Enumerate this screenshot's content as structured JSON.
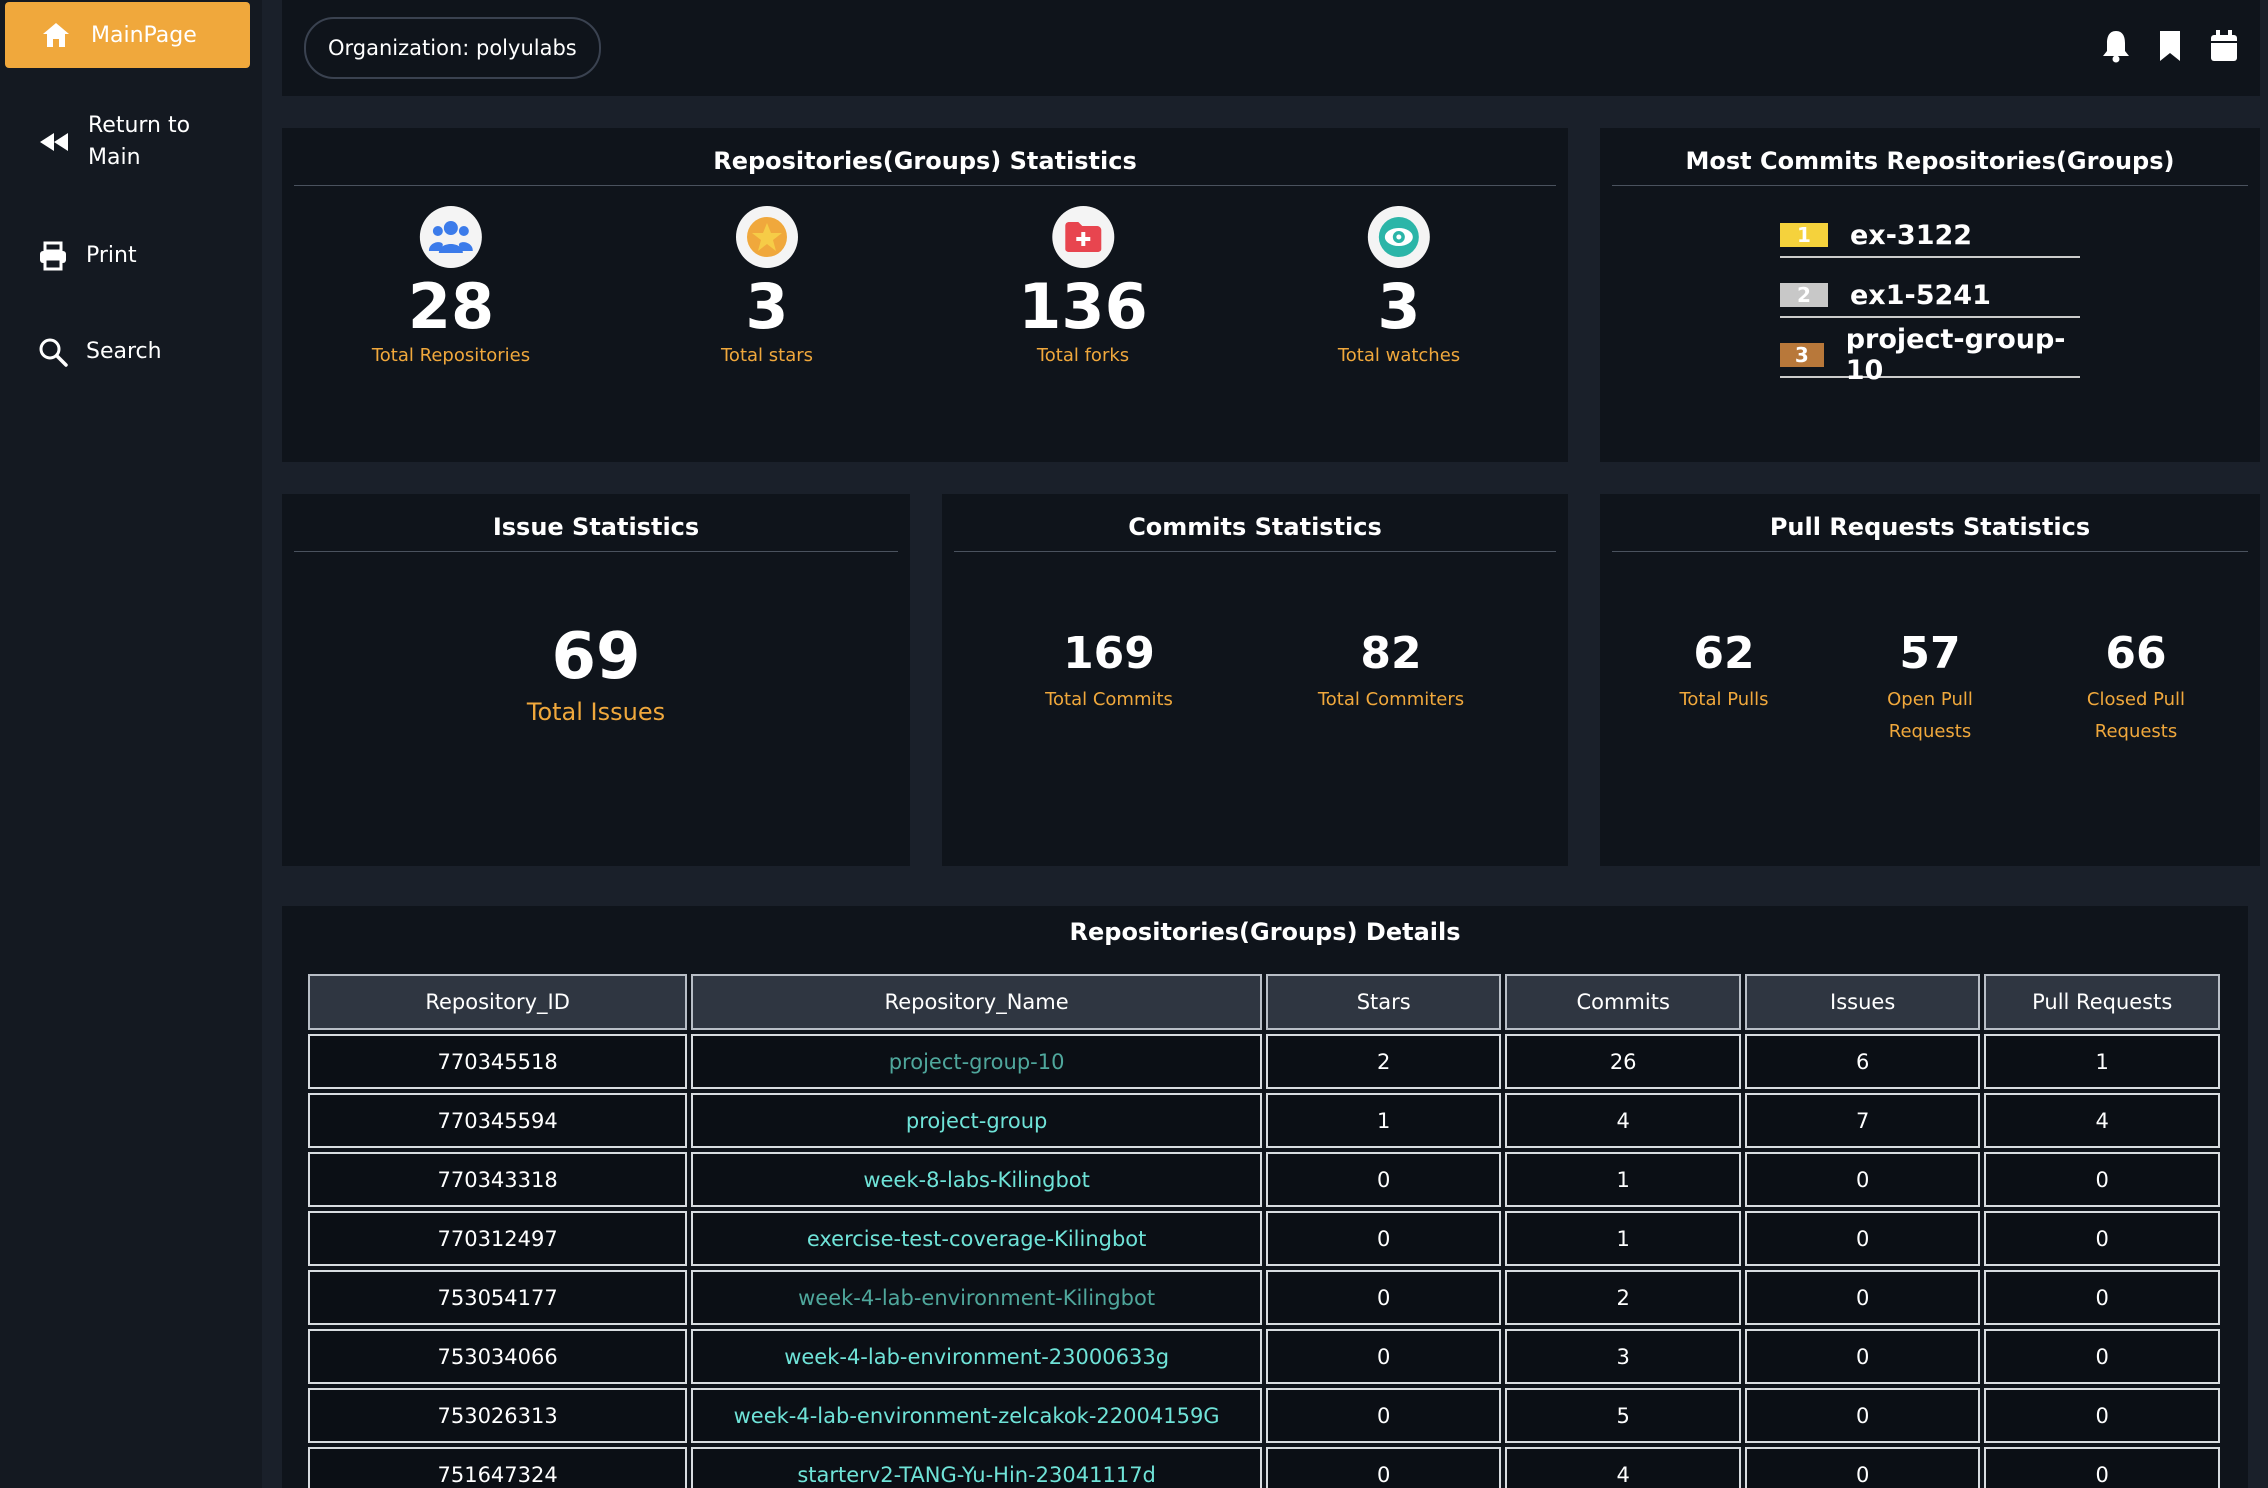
{
  "sidebar": {
    "main": "MainPage",
    "return": "Return to Main",
    "print": "Print",
    "search": "Search"
  },
  "header": {
    "organization": "Organization: polyulabs",
    "icons": [
      "bell-icon",
      "bookmark-icon",
      "calendar-icon"
    ]
  },
  "repo_stats": {
    "title": "Repositories(Groups) Statistics",
    "items": [
      {
        "value": "28",
        "label": "Total Repositories",
        "icon": "users-icon"
      },
      {
        "value": "3",
        "label": "Total stars",
        "icon": "star-icon"
      },
      {
        "value": "136",
        "label": "Total forks",
        "icon": "folder-plus-icon"
      },
      {
        "value": "3",
        "label": "Total watches",
        "icon": "eye-icon"
      }
    ]
  },
  "most_commits": {
    "title": "Most Commits Repositories(Groups)",
    "items": [
      {
        "rank": "1",
        "name": "ex-3122",
        "color": "#f5d23c"
      },
      {
        "rank": "2",
        "name": "ex1-5241",
        "color": "#c8c8c8"
      },
      {
        "rank": "3",
        "name": "project-group-10",
        "color": "#b8783a"
      }
    ]
  },
  "issue_stats": {
    "title": "Issue Statistics",
    "value": "69",
    "label": "Total Issues"
  },
  "commit_stats": {
    "title": "Commits Statistics",
    "items": [
      {
        "value": "169",
        "label": "Total Commits"
      },
      {
        "value": "82",
        "label": "Total Commiters"
      }
    ]
  },
  "pr_stats": {
    "title": "Pull Requests Statistics",
    "items": [
      {
        "value": "62",
        "label": "Total Pulls"
      },
      {
        "value": "57",
        "label": "Open Pull Requests"
      },
      {
        "value": "66",
        "label": "Closed Pull Requests"
      }
    ]
  },
  "details": {
    "title": "Repositories(Groups) Details",
    "columns": [
      "Repository_ID",
      "Repository_Name",
      "Stars",
      "Commits",
      "Issues",
      "Pull Requests"
    ],
    "rows": [
      [
        "770345518",
        "project-group-10",
        "2",
        "26",
        "6",
        "1"
      ],
      [
        "770345594",
        "project-group",
        "1",
        "4",
        "7",
        "4"
      ],
      [
        "770343318",
        "week-8-labs-Kilingbot",
        "0",
        "1",
        "0",
        "0"
      ],
      [
        "770312497",
        "exercise-test-coverage-Kilingbot",
        "0",
        "1",
        "0",
        "0"
      ],
      [
        "753054177",
        "week-4-lab-environment-Kilingbot",
        "0",
        "2",
        "0",
        "0"
      ],
      [
        "753034066",
        "week-4-lab-environment-23000633g",
        "0",
        "3",
        "0",
        "0"
      ],
      [
        "753026313",
        "week-4-lab-environment-zelcakok-22004159G",
        "0",
        "5",
        "0",
        "0"
      ],
      [
        "751647324",
        "starterv2-TANG-Yu-Hin-23041117d",
        "0",
        "4",
        "0",
        "0"
      ]
    ]
  },
  "colors": {
    "accent": "#f0a83c",
    "link": "#6fe3d8",
    "panel": "#0f141b",
    "background": "#1a202a"
  }
}
